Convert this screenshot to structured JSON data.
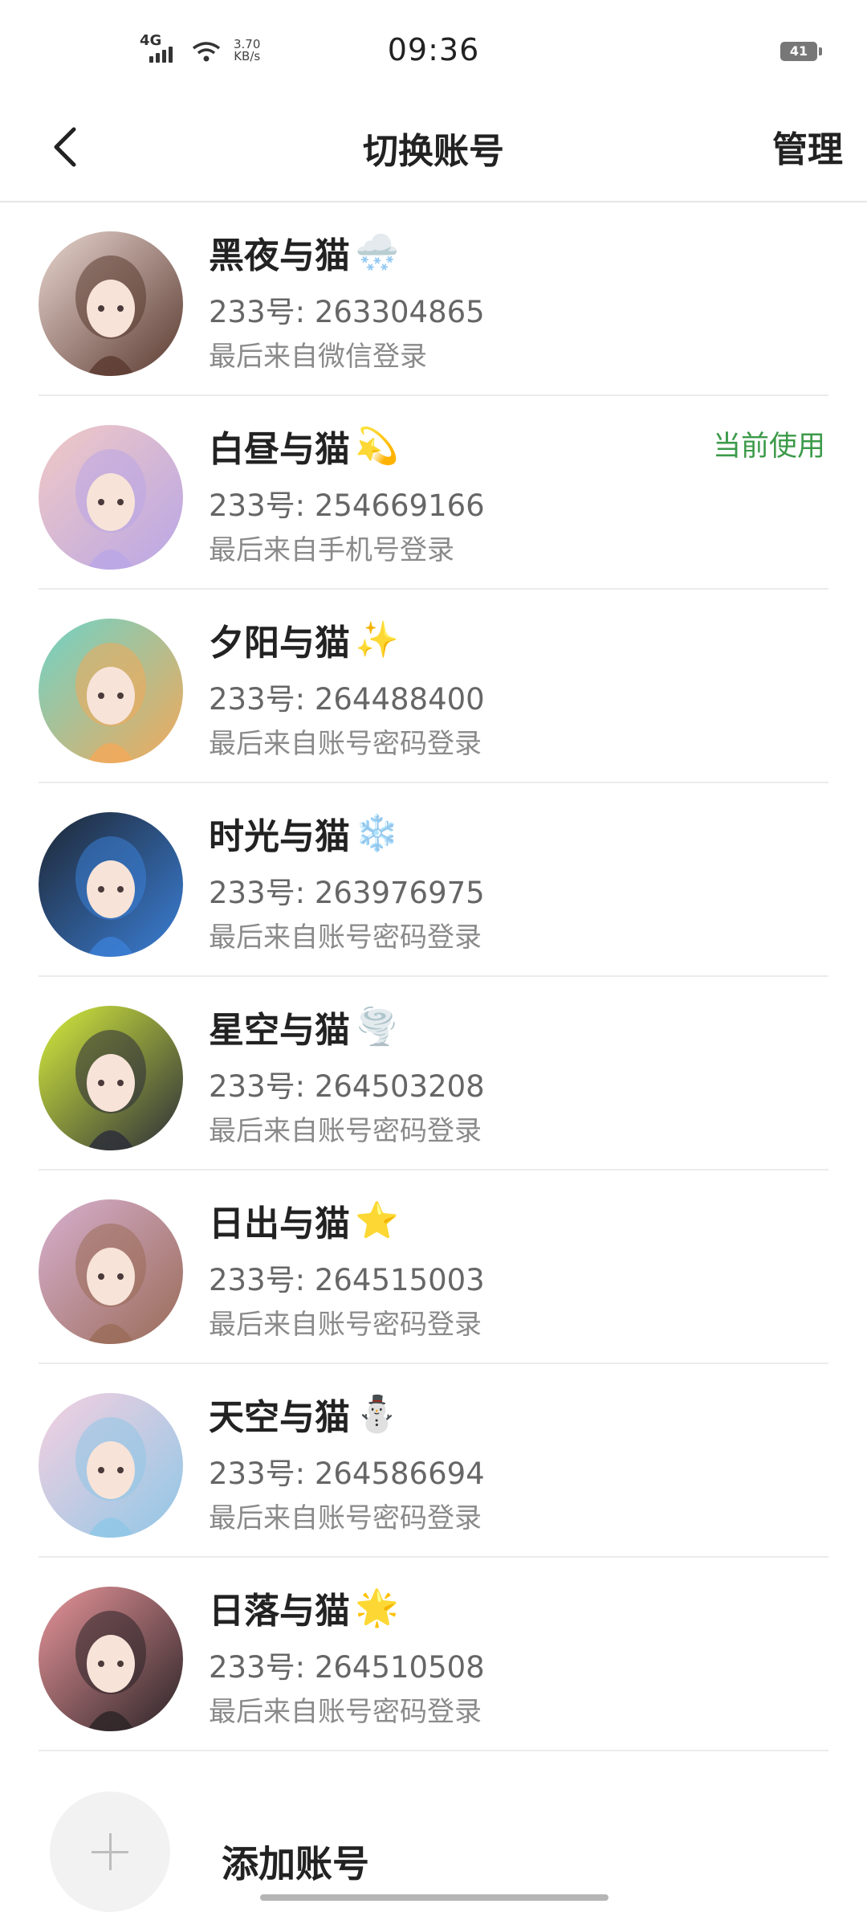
{
  "status": {
    "network": "4G",
    "speed_value": "3.70",
    "speed_unit": "KB/s",
    "time": "09:36",
    "battery": "41"
  },
  "header": {
    "title": "切换账号",
    "manage_label": "管理"
  },
  "accounts": [
    {
      "name": "黑夜与猫",
      "emoji": "🌨️",
      "uid": "233号: 263304865",
      "last_login": "最后来自微信登录",
      "current": "",
      "colors": [
        "#e9d6d0",
        "#5a3a30"
      ]
    },
    {
      "name": "白昼与猫",
      "emoji": "💫",
      "uid": "233号: 254669166",
      "last_login": "最后来自手机号登录",
      "current": "当前使用",
      "colors": [
        "#f1c9c4",
        "#b9a6e6"
      ]
    },
    {
      "name": "夕阳与猫",
      "emoji": "✨",
      "uid": "233号: 264488400",
      "last_login": "最后来自账号密码登录",
      "current": "",
      "colors": [
        "#6fd3c7",
        "#f2a95a"
      ]
    },
    {
      "name": "时光与猫",
      "emoji": "❄️",
      "uid": "233号: 263976975",
      "last_login": "最后来自账号密码登录",
      "current": "",
      "colors": [
        "#1e2633",
        "#3b7fd6"
      ]
    },
    {
      "name": "星空与猫",
      "emoji": "🌪️",
      "uid": "233号: 264503208",
      "last_login": "最后来自账号密码登录",
      "current": "",
      "colors": [
        "#d7ef3c",
        "#2b2c3a"
      ]
    },
    {
      "name": "日出与猫",
      "emoji": "⭐",
      "uid": "233号: 264515003",
      "last_login": "最后来自账号密码登录",
      "current": "",
      "colors": [
        "#d7b0cf",
        "#9a6b58"
      ]
    },
    {
      "name": "天空与猫",
      "emoji": "⛄",
      "uid": "233号: 264586694",
      "last_login": "最后来自账号密码登录",
      "current": "",
      "colors": [
        "#f6cfe0",
        "#8fc7e6"
      ]
    },
    {
      "name": "日落与猫",
      "emoji": "🌟",
      "uid": "233号: 264510508",
      "last_login": "最后来自账号密码登录",
      "current": "",
      "colors": [
        "#e9969b",
        "#2a2326"
      ]
    }
  ],
  "add_account": {
    "label": "添加账号"
  }
}
